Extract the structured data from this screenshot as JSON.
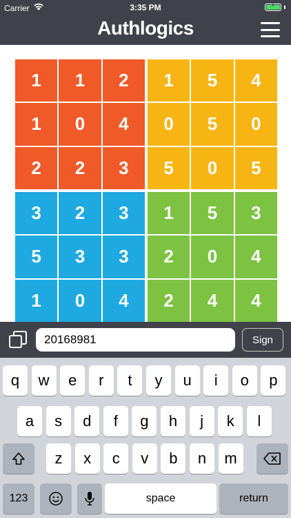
{
  "status_bar": {
    "carrier": "Carrier",
    "time": "3:35 PM",
    "wifi_icon": "wifi-icon",
    "battery_icon": "battery-charging-icon",
    "battery_color": "#4cd964",
    "battery_level": 1.0
  },
  "header": {
    "logo": "Authlogics",
    "menu_icon": "hamburger-menu-icon",
    "background": "#3f424b"
  },
  "grid": {
    "quadrants": [
      {
        "color": "#f05a28",
        "cells": [
          "1",
          "1",
          "2",
          "1",
          "0",
          "4",
          "2",
          "2",
          "3"
        ]
      },
      {
        "color": "#f7b514",
        "cells": [
          "1",
          "5",
          "4",
          "0",
          "5",
          "0",
          "5",
          "0",
          "5"
        ]
      },
      {
        "color": "#1fa9e1",
        "cells": [
          "3",
          "2",
          "3",
          "5",
          "3",
          "3",
          "1",
          "0",
          "4"
        ]
      },
      {
        "color": "#7dc241",
        "cells": [
          "1",
          "5",
          "3",
          "2",
          "0",
          "4",
          "2",
          "4",
          "4"
        ]
      }
    ]
  },
  "input_bar": {
    "copy_icon": "copy-icon",
    "value": "20168981",
    "sign_label": "Sign"
  },
  "keyboard": {
    "row1": [
      "q",
      "w",
      "e",
      "r",
      "t",
      "y",
      "u",
      "i",
      "o",
      "p"
    ],
    "row2": [
      "a",
      "s",
      "d",
      "f",
      "g",
      "h",
      "j",
      "k",
      "l"
    ],
    "row3": [
      "z",
      "x",
      "c",
      "v",
      "b",
      "n",
      "m"
    ],
    "shift_icon": "shift-icon",
    "backspace_icon": "backspace-icon",
    "numbers_label": "123",
    "emoji_icon": "emoji-icon",
    "mic_icon": "microphone-icon",
    "space_label": "space",
    "return_label": "return"
  }
}
